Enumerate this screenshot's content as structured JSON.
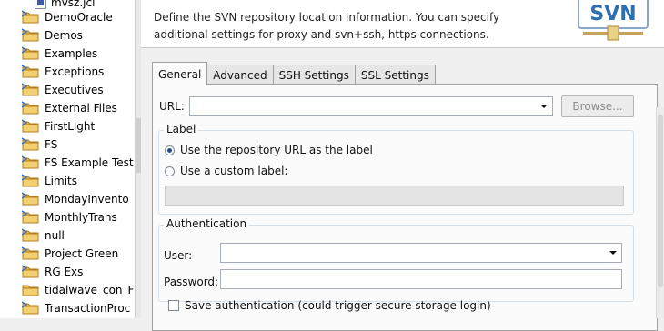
{
  "tree": {
    "items": [
      {
        "label": "mvsz.jcl",
        "icon": "file-icon",
        "top": 0
      },
      {
        "label": "DemoOracle",
        "icon": "project-folder-icon"
      },
      {
        "label": "Demos",
        "icon": "project-folder-icon"
      },
      {
        "label": "Examples",
        "icon": "project-folder-icon"
      },
      {
        "label": "Exceptions",
        "icon": "project-folder-icon"
      },
      {
        "label": "Executives",
        "icon": "project-folder-icon"
      },
      {
        "label": "External Files",
        "icon": "project-folder-icon"
      },
      {
        "label": "FirstLight",
        "icon": "project-folder-icon"
      },
      {
        "label": "FS",
        "icon": "project-folder-icon"
      },
      {
        "label": "FS Example Test",
        "icon": "project-folder-icon"
      },
      {
        "label": "Limits",
        "icon": "project-folder-icon"
      },
      {
        "label": "MondayInvento",
        "icon": "project-folder-icon"
      },
      {
        "label": "MonthlyTrans",
        "icon": "project-folder-icon"
      },
      {
        "label": "null",
        "icon": "project-folder-icon"
      },
      {
        "label": "Project Green",
        "icon": "project-folder-icon"
      },
      {
        "label": "RG Exs",
        "icon": "project-folder-icon"
      },
      {
        "label": "tidalwave_con_F",
        "icon": "folder-icon"
      },
      {
        "label": "TransactionProc",
        "icon": "project-folder-icon"
      }
    ]
  },
  "dialog": {
    "description_line1": "Define the SVN repository location information. You can specify",
    "description_line2": "additional settings for proxy and svn+ssh, https connections.",
    "logo_text": "SVN",
    "tabs": [
      "General",
      "Advanced",
      "SSH Settings",
      "SSL Settings"
    ],
    "active_tab": "General",
    "url_label": "URL:",
    "url_value": "",
    "browse_label": "Browse...",
    "label_group_title": "Label",
    "radio_repo_url": "Use the repository URL as the label",
    "radio_custom": "Use a custom label:",
    "custom_label_value": "",
    "auth_group_title": "Authentication",
    "user_label": "User:",
    "user_value": "",
    "password_label": "Password:",
    "password_value": "",
    "save_auth_label": "Save authentication (could trigger secure storage login)"
  },
  "colors": {
    "accent": "#3c5aa8",
    "folder": "#e8b64a",
    "logo_blue": "#2f6fb0"
  }
}
